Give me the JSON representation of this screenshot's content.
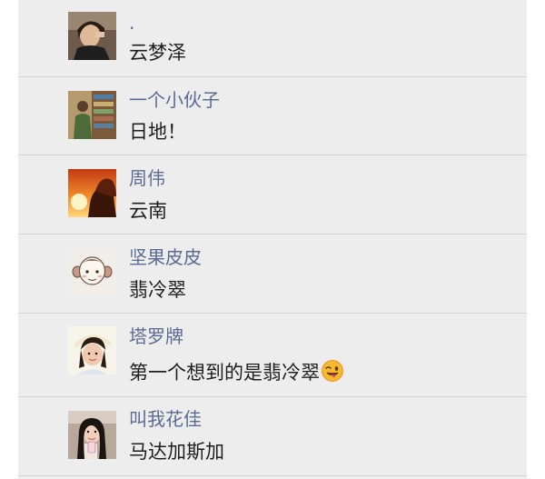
{
  "comments": [
    {
      "name": ".",
      "text": "云梦泽",
      "avatar": "woman-portrait-dark-avatar"
    },
    {
      "name": "一个小伙子",
      "text": "日地！",
      "avatar": "man-at-bookshelf-avatar"
    },
    {
      "name": "周伟",
      "text": "云南",
      "avatar": "sunset-silhouette-avatar"
    },
    {
      "name": "坚果皮皮",
      "text": "翡冷翠",
      "avatar": "cartoon-monkey-sketch-avatar"
    },
    {
      "name": "塔罗牌",
      "text": "第一个想到的是翡冷翠",
      "avatar": "girl-with-hat-avatar",
      "emoji": "winking-tongue-emoji"
    },
    {
      "name": "叫我花佳",
      "text": "马达加斯加",
      "avatar": "girl-selfie-avatar"
    }
  ],
  "colors": {
    "name": "#5b6b93",
    "text": "#1e1e1e",
    "background": "#ededed",
    "divider": "#d4d4d4"
  }
}
